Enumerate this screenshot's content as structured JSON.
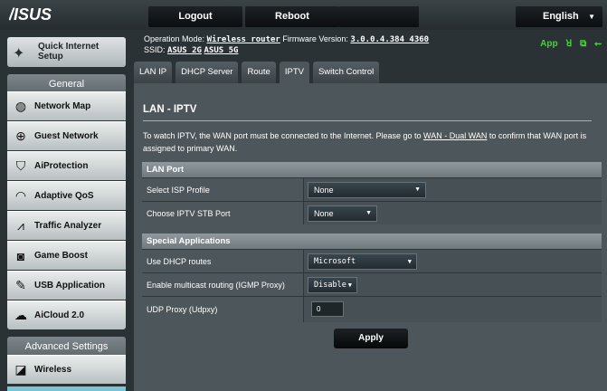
{
  "brand": {
    "logo_text": "/ISUS"
  },
  "topbar": {
    "logout_label": "Logout",
    "reboot_label": "Reboot",
    "language": "English"
  },
  "sidebar": {
    "quick_setup": {
      "line1": "Quick Internet",
      "line2": "Setup",
      "icon": "wand-icon"
    },
    "general_header": "General",
    "items": [
      {
        "label": "Network Map",
        "icon": "globe-icon"
      },
      {
        "label": "Guest Network",
        "icon": "guest-globe-icon"
      },
      {
        "label": "AiProtection",
        "icon": "lock-icon"
      },
      {
        "label": "Adaptive QoS",
        "icon": "gauge-icon"
      },
      {
        "label": "Traffic Analyzer",
        "icon": "chart-icon"
      },
      {
        "label": "Game Boost",
        "icon": "gamepad-icon"
      },
      {
        "label": "USB Application",
        "icon": "usb-icon"
      },
      {
        "label": "AiCloud 2.0",
        "icon": "cloud-icon"
      }
    ],
    "advanced_header": "Advanced Settings",
    "advanced_items": [
      {
        "label": "Wireless",
        "icon": "wifi-icon"
      }
    ]
  },
  "status": {
    "opmode_label": "Operation Mode:",
    "opmode_value": "Wireless router",
    "firmware_label": "Firmware Version:",
    "firmware_value": "3.0.0.4.384_4360",
    "ssid_label": "SSID:",
    "ssid_2g": "ASUS_2G",
    "ssid_5g": "ASUS_5G",
    "app_label": "App"
  },
  "tabs": [
    "LAN IP",
    "DHCP Server",
    "Route",
    "IPTV",
    "Switch Control"
  ],
  "active_tab": "IPTV",
  "page": {
    "title": "LAN - IPTV",
    "desc_part1": "To watch IPTV, the WAN port must be connected to the Internet. Please go to",
    "desc_link": "WAN - Dual WAN",
    "desc_part2": "to confirm that WAN port is assigned to primary WAN."
  },
  "lan_port": {
    "header": "LAN Port",
    "isp_profile_label": "Select ISP Profile",
    "isp_profile_value": "None",
    "stb_port_label": "Choose IPTV STB Port",
    "stb_port_value": "None"
  },
  "special_apps": {
    "header": "Special Applications",
    "dhcp_routes_label": "Use DHCP routes",
    "dhcp_routes_value": "Microsoft",
    "multicast_label": "Enable multicast routing (IGMP Proxy)",
    "multicast_value": "Disable",
    "udpxy_label": "UDP Proxy (Udpxy)",
    "udpxy_value": "0"
  },
  "apply_label": "Apply",
  "colors": {
    "accent": "#78c1d7",
    "status_green": "#48d13a",
    "panel_bg": "#4d565a"
  }
}
